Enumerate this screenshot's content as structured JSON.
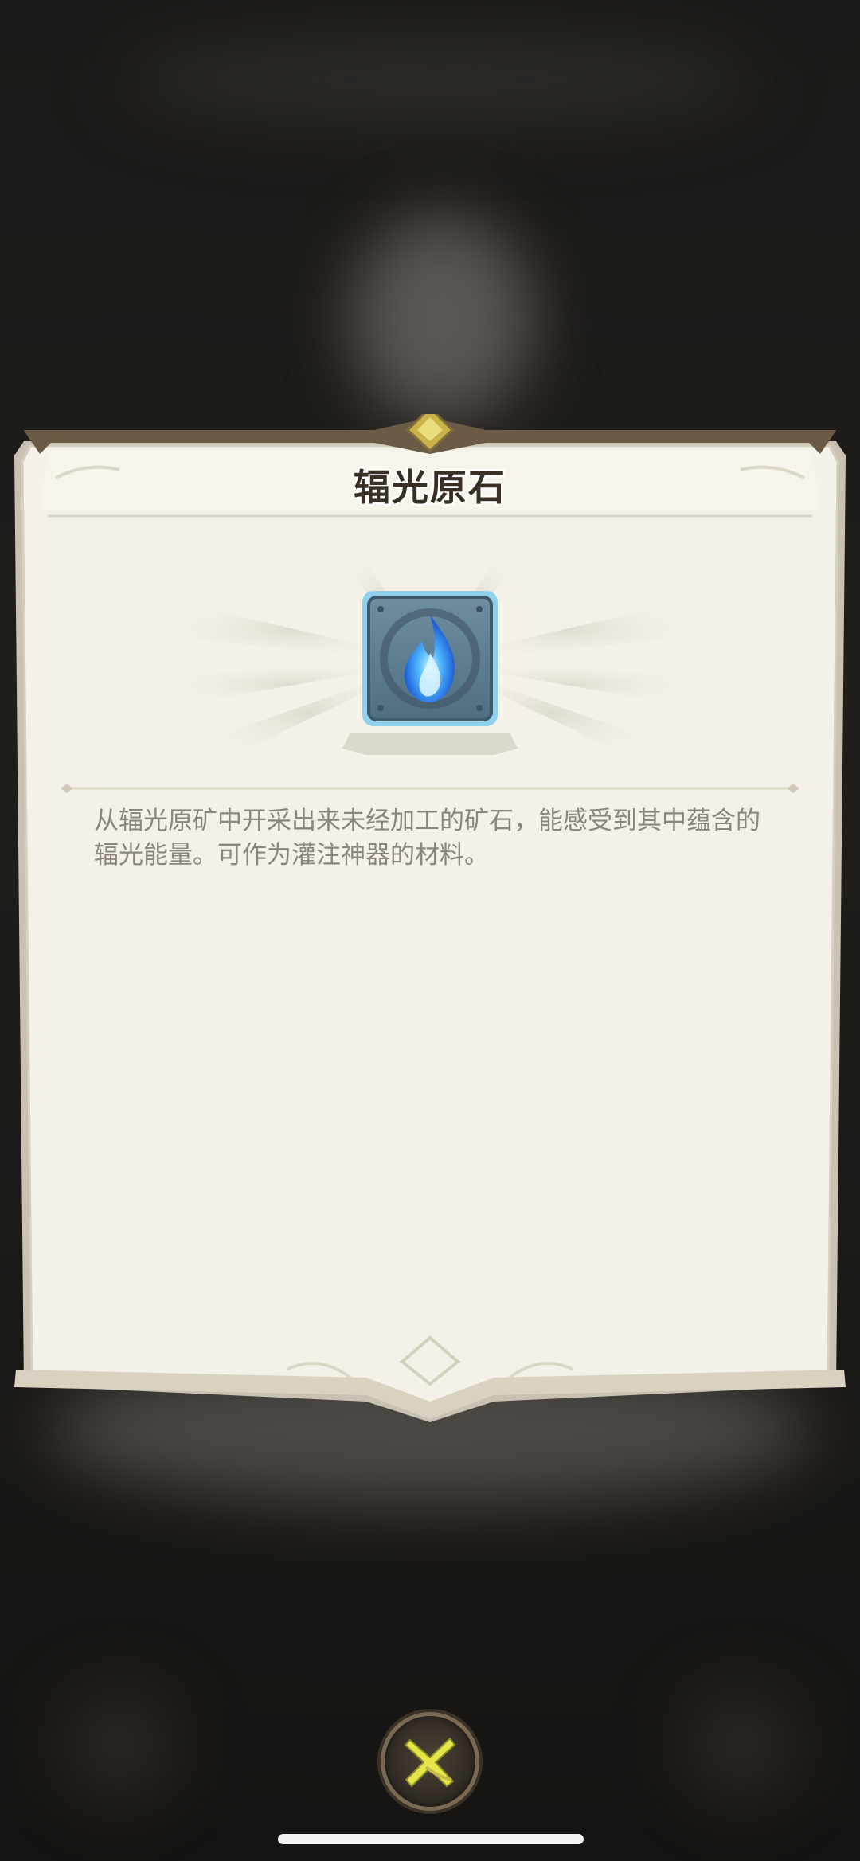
{
  "item": {
    "title": "辐光原石",
    "icon": "blue-flame-ore-icon",
    "description": "从辐光原矿中开采出来未经加工的矿石，能感受到其中蕴含的辐光能量。可作为灌注神器的材料。"
  },
  "close_button": {
    "icon": "close-x-icon"
  },
  "colors": {
    "parchment": "#f4f1e8",
    "frame": "#6b5a45",
    "title_text": "#3a2f25",
    "description_text": "#8d857b",
    "icon_frame": "#5ba6c9",
    "flame": "#5fc0ff",
    "close_x": "#e8e84a"
  }
}
